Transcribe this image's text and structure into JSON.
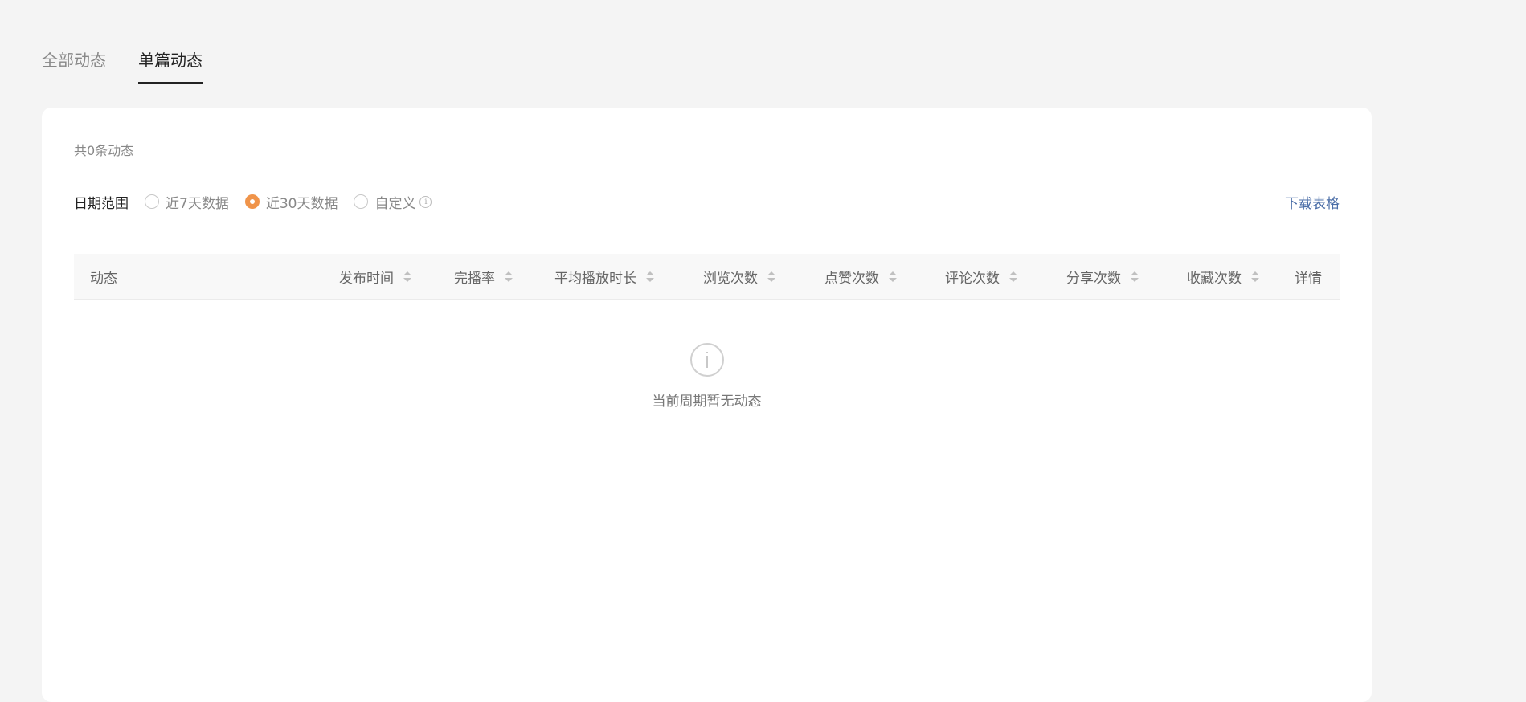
{
  "tabs": [
    {
      "label": "全部动态",
      "active": false
    },
    {
      "label": "单篇动态",
      "active": true
    }
  ],
  "summary": {
    "total_text": "共0条动态"
  },
  "filter": {
    "label": "日期范围",
    "options": [
      {
        "label": "近7天数据",
        "checked": false
      },
      {
        "label": "近30天数据",
        "checked": true
      },
      {
        "label": "自定义",
        "checked": false
      }
    ],
    "info_glyph": "i",
    "download_label": "下载表格"
  },
  "table": {
    "columns": [
      {
        "label": "动态",
        "sortable": false
      },
      {
        "label": "发布时间",
        "sortable": true
      },
      {
        "label": "完播率",
        "sortable": true
      },
      {
        "label": "平均播放时长",
        "sortable": true
      },
      {
        "label": "浏览次数",
        "sortable": true
      },
      {
        "label": "点赞次数",
        "sortable": true
      },
      {
        "label": "评论次数",
        "sortable": true
      },
      {
        "label": "分享次数",
        "sortable": true
      },
      {
        "label": "收藏次数",
        "sortable": true
      },
      {
        "label": "详情",
        "sortable": false
      }
    ],
    "rows": []
  },
  "empty_state": {
    "text": "当前周期暂无动态",
    "icon": "info-circle-icon"
  },
  "colors": {
    "accent": "#f0944a",
    "link": "#4a6da7",
    "page_background": "#f4f4f4",
    "card_background": "#ffffff"
  }
}
